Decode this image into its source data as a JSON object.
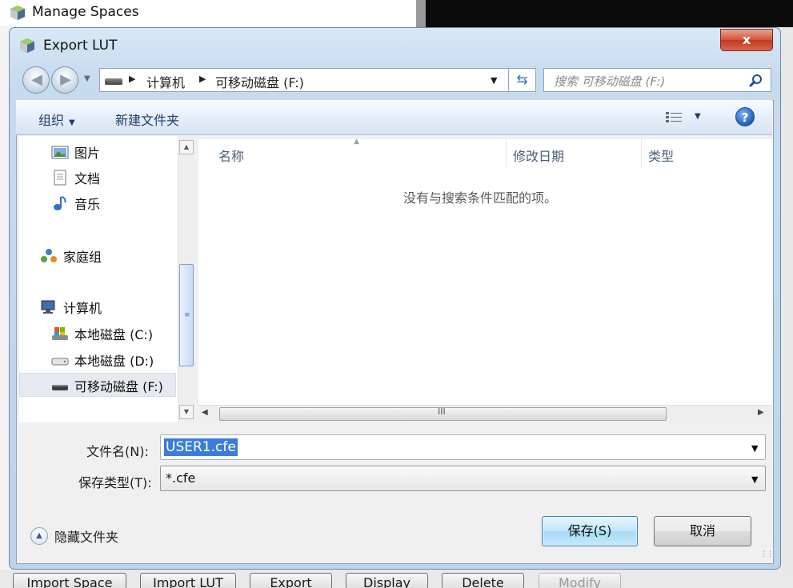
{
  "background_window": {
    "title": "Manage Spaces",
    "buttons": [
      "Import Space",
      "Import LUT",
      "Export",
      "Display",
      "Delete",
      "Modify"
    ]
  },
  "dialog": {
    "title": "Export LUT",
    "close_label": "x",
    "address": {
      "segments": [
        "计算机",
        "可移动磁盘 (F:)"
      ]
    },
    "search": {
      "placeholder": "搜索 可移动磁盘 (F:)"
    },
    "toolbar": {
      "organize_label": "组织",
      "new_folder_label": "新建文件夹"
    },
    "nav": {
      "pictures": "图片",
      "documents": "文档",
      "music": "音乐",
      "homegroup": "家庭组",
      "computer": "计算机",
      "drive_c": "本地磁盘 (C:)",
      "drive_d": "本地磁盘 (D:)",
      "drive_f": "可移动磁盘 (F:)"
    },
    "columns": {
      "name": "名称",
      "date_modified": "修改日期",
      "type": "类型"
    },
    "empty_message": "没有与搜索条件匹配的项。",
    "filename_label": "文件名(N):",
    "filename_value": "USER1.cfe",
    "filetype_label": "保存类型(T):",
    "filetype_value": "*.cfe",
    "hide_folders_label": "隐藏文件夹",
    "save_label": "保存(S)",
    "cancel_label": "取消",
    "scroll_grip": "III"
  },
  "colors": {
    "selection": "#3a7cd9",
    "frame": "#c7dbee",
    "close": "#c23a22"
  }
}
